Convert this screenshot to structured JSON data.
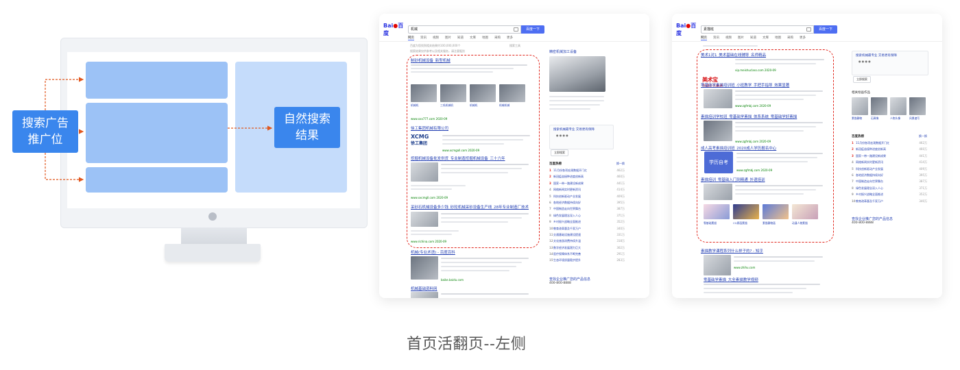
{
  "diagram": {
    "ads_label": "搜索广告\n推广位",
    "organic_label": "自然搜索\n结果",
    "accent_color": "#3a86ed",
    "arrow_color": "#e1581f"
  },
  "left_card": {
    "search_query": "机械",
    "search_button": "百度一下",
    "tabs": [
      "网页",
      "资讯",
      "视频",
      "图片",
      "知道",
      "文库",
      "地图",
      "采购",
      "更多"
    ],
    "result_count": "百度为您找到相关结果约100,000,000个",
    "tool_label": "搜索工具",
    "note": "搜索结果仅供参考以及相关服务，请注意甄别",
    "ads": [
      {
        "title": "制砂机械设备_新型机械",
        "url": "www.xxx777.com 2020-09"
      },
      {
        "title": "徐工集团机械有限公司",
        "url": "www.xcmgall.com 2020-09"
      },
      {
        "title": "挖掘机械设备批发供货_专业制造挖掘机械设备_三十六年",
        "url": "www.xxcmgll.com 2020-09"
      },
      {
        "title": "采砂石机械设备多少钱_砂轮机械采砂设备生产线_28年专业制造厂技术",
        "url": "www.richina.com 2020-09"
      }
    ],
    "xcmg_logo": [
      "XCMG",
      "徐工集团"
    ],
    "thumb_captions": [
      "机械机",
      "三巩机械机",
      "机械机",
      "机械机械"
    ],
    "organic": [
      {
        "title": "机械(专业术语) - 百度百科",
        "url": "baike.baidu.com"
      },
      {
        "title": "机械基础资料网"
      }
    ],
    "side": {
      "product_title": "精密机械加工设备",
      "trust_line": "搜索机械最专业 交易更有保障",
      "verify_button": "立即搜索",
      "hot_title": "百度热榜",
      "hot_more": "换一换",
      "hot_items": [
        {
          "rank": "1",
          "text": "11月份各项宏观数据开门红",
          "value": "462万"
        },
        {
          "rank": "2",
          "text": "新冠疫苗接种进度创新高",
          "value": "460万"
        },
        {
          "rank": "3",
          "text": "国家一带一路建设新成果",
          "value": "441万"
        },
        {
          "rank": "4",
          "text": "网络新闻实时更新资讯",
          "value": "414万"
        },
        {
          "rank": "5",
          "text": "科技创新驱动产业发展",
          "value": "409万"
        },
        {
          "rank": "6",
          "text": "各地经济数据持续向好",
          "value": "395万"
        },
        {
          "rank": "7",
          "text": "中国制造走向世界舞台",
          "value": "387万"
        },
        {
          "rank": "8",
          "text": "绿色发展理念深入人心",
          "value": "371万"
        },
        {
          "rank": "9",
          "text": "乡村振兴战略全面推进",
          "value": "352万"
        },
        {
          "rank": "10",
          "text": "教育改革惠及千家万户",
          "value": "340万"
        },
        {
          "rank": "11",
          "text": "交通基础设施建设提速",
          "value": "331万"
        },
        {
          "rank": "12",
          "text": "文化旅游消费持续升温",
          "value": "318万"
        },
        {
          "rank": "13",
          "text": "数字经济发展潜力巨大",
          "value": "302万"
        },
        {
          "rank": "14",
          "text": "医疗保障体系不断完善",
          "value": "291万"
        },
        {
          "rank": "15",
          "text": "生态环境质量稳步提升",
          "value": "283万"
        }
      ],
      "footer": "查找企业推广您的产品信息",
      "phone": "400-800-8888"
    }
  },
  "right_card": {
    "search_query": "素描班",
    "search_button": "百度一下",
    "tabs": [
      "网页",
      "资讯",
      "视频",
      "图片",
      "知道",
      "文库",
      "地图",
      "采购",
      "更多"
    ],
    "ads": [
      {
        "title": "美术1对1_美术基础在线辅导_名师精品",
        "url": "vip.meishuclass.com 2020-09"
      },
      {
        "title": "零基础学素描培训班_小班教学_手把手指导_效果显著",
        "url": "www.zgfmbj.com 2020-09"
      },
      {
        "title": "素描培训学校班_零基础学素描_体系系统_零基础学好素描",
        "url": "www.zgfmbj.com 2020-09"
      },
      {
        "title": "成人高考素描培训班_2020成人学历报名中心",
        "url": "www.zgfmbj.com 2020-09"
      },
      {
        "title": "素描培训_零基础入门到精通_外语培训",
        "url": "www.zgfmbj.com 2020-09"
      }
    ],
    "meishu_logo": [
      "美术宝",
      "在线少儿美术"
    ],
    "xuelikao_label": "学历自考",
    "thumb_captions": [
      "零基础素描",
      "CG原画素描",
      "素描静物画",
      "动漫人物素描"
    ],
    "organic": [
      {
        "title": "素描教学课程系列什么样子的? - 知乎",
        "url": "www.zhihu.com"
      },
      {
        "title": "零基础学素描_大全素描教学视频"
      }
    ],
    "side": {
      "trust_line": "搜索机械最专业 交易更有保障",
      "verify_button": "立即搜索",
      "related_title": "相关绘画作品",
      "related_captions": [
        "素描静物",
        "石膏像",
        "人物头像",
        "风景速写",
        "创意素描"
      ],
      "hot_title": "百度热榜",
      "hot_more": "换一换",
      "hot_items": [
        {
          "rank": "1",
          "text": "11月份各项宏观数据开门红",
          "value": "462万"
        },
        {
          "rank": "2",
          "text": "新冠疫苗接种进度创新高",
          "value": "460万"
        },
        {
          "rank": "3",
          "text": "国家一带一路建设新成果",
          "value": "441万"
        },
        {
          "rank": "4",
          "text": "网络新闻实时更新资讯",
          "value": "414万"
        },
        {
          "rank": "5",
          "text": "科技创新驱动产业发展",
          "value": "409万"
        },
        {
          "rank": "6",
          "text": "各地经济数据持续向好",
          "value": "395万"
        },
        {
          "rank": "7",
          "text": "中国制造走向世界舞台",
          "value": "387万"
        },
        {
          "rank": "8",
          "text": "绿色发展理念深入人心",
          "value": "371万"
        },
        {
          "rank": "9",
          "text": "乡村振兴战略全面推进",
          "value": "352万"
        },
        {
          "rank": "10",
          "text": "教育改革惠及千家万户",
          "value": "340万"
        }
      ],
      "footer": "查找企业推广您的产品信息",
      "phone": "400-800-8888"
    }
  },
  "caption": "首页活翻页--左侧"
}
